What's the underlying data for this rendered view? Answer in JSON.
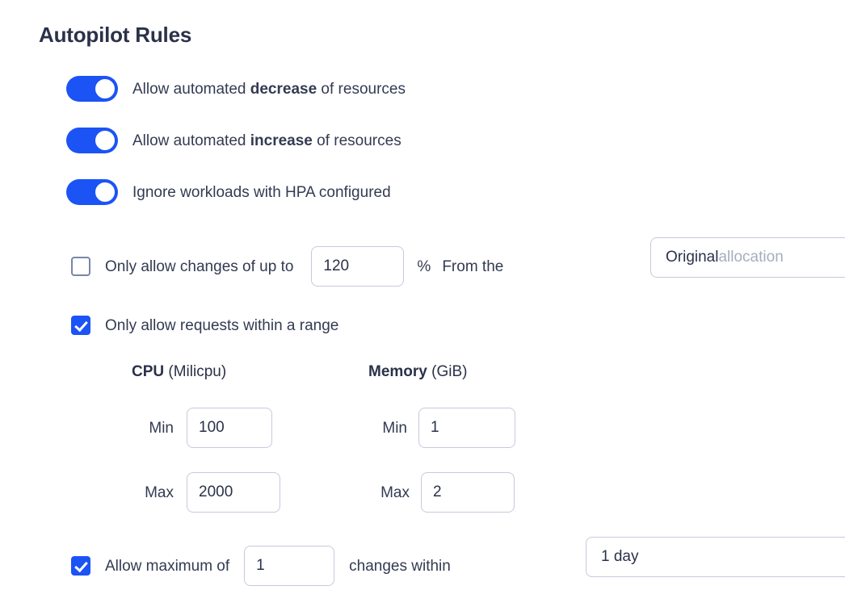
{
  "header": {
    "title": "Autopilot Rules"
  },
  "toggles": [
    {
      "name": "allow-automated-decrease",
      "label_before": "Allow automated ",
      "label_strong": "decrease",
      "label_after": " of resources",
      "state": "on"
    },
    {
      "name": "allow-automated-increase",
      "label_before": "Allow automated ",
      "label_strong": "increase",
      "label_after": " of resources",
      "state": "on"
    },
    {
      "name": "ignore-hpa-workloads",
      "label_before": "Ignore workloads with HPA configured",
      "label_strong": "",
      "label_after": "",
      "state": "on"
    }
  ],
  "change_limit": {
    "checkbox_state": "unchecked",
    "label": "Only allow changes of up to",
    "value": "120",
    "unit": "%",
    "from_label": "From the",
    "source_value": "Original ",
    "source_value_muted": "allocation"
  },
  "range": {
    "checkbox_state": "checked",
    "label": "Only allow requests within a range",
    "columns": [
      {
        "name": "cpu",
        "title": "CPU",
        "unit": "(Milicpu)",
        "min_label": "Min",
        "min_value": "100",
        "max_label": "Max",
        "max_value": "2000"
      },
      {
        "name": "memory",
        "title": "Memory",
        "unit": "(GiB)",
        "min_label": "Min",
        "min_value": "1",
        "max_label": "Max",
        "max_value": "2"
      }
    ]
  },
  "change_frequency": {
    "checkbox_state": "checked",
    "label_before": "Allow maximum of",
    "count_value": "1",
    "label_after": "changes within",
    "period_value": "1 day"
  },
  "colors": {
    "accent_blue": "#1b53f5",
    "text_dark": "#2b3149",
    "text_body": "#333b52",
    "border_input": "#c5cbdc",
    "border_checkbox": "#7a86a8",
    "muted_text": "#a7adbe",
    "background": "#ffffff"
  }
}
